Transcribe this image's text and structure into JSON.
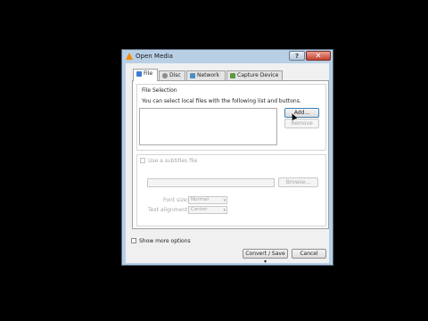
{
  "window": {
    "title": "Open Media",
    "help_label": "?",
    "close_label": "✕"
  },
  "tabs": [
    {
      "label": "File",
      "icon": "file-icon",
      "color": "#3a7bd5",
      "active": true
    },
    {
      "label": "Disc",
      "icon": "disc-icon",
      "color": "#8a8a8a",
      "active": false
    },
    {
      "label": "Network",
      "icon": "network-icon",
      "color": "#4a90c8",
      "active": false
    },
    {
      "label": "Capture Device",
      "icon": "capture-device-icon",
      "color": "#5a9b3c",
      "active": false
    }
  ],
  "file_selection": {
    "group_title": "File Selection",
    "instructions": "You can select local files with the following list and buttons.",
    "add_label": "Add...",
    "remove_label": "Remove"
  },
  "subtitles": {
    "checkbox_label": "Use a subtitles file",
    "browse_label": "Browse...",
    "font_size_label": "Font size:",
    "font_size_value": "Normal",
    "alignment_label": "Text alignment:",
    "alignment_value": "Center"
  },
  "footer": {
    "show_more_label": "Show more options",
    "convert_label": "Convert / Save",
    "cancel_label": "Cancel"
  }
}
